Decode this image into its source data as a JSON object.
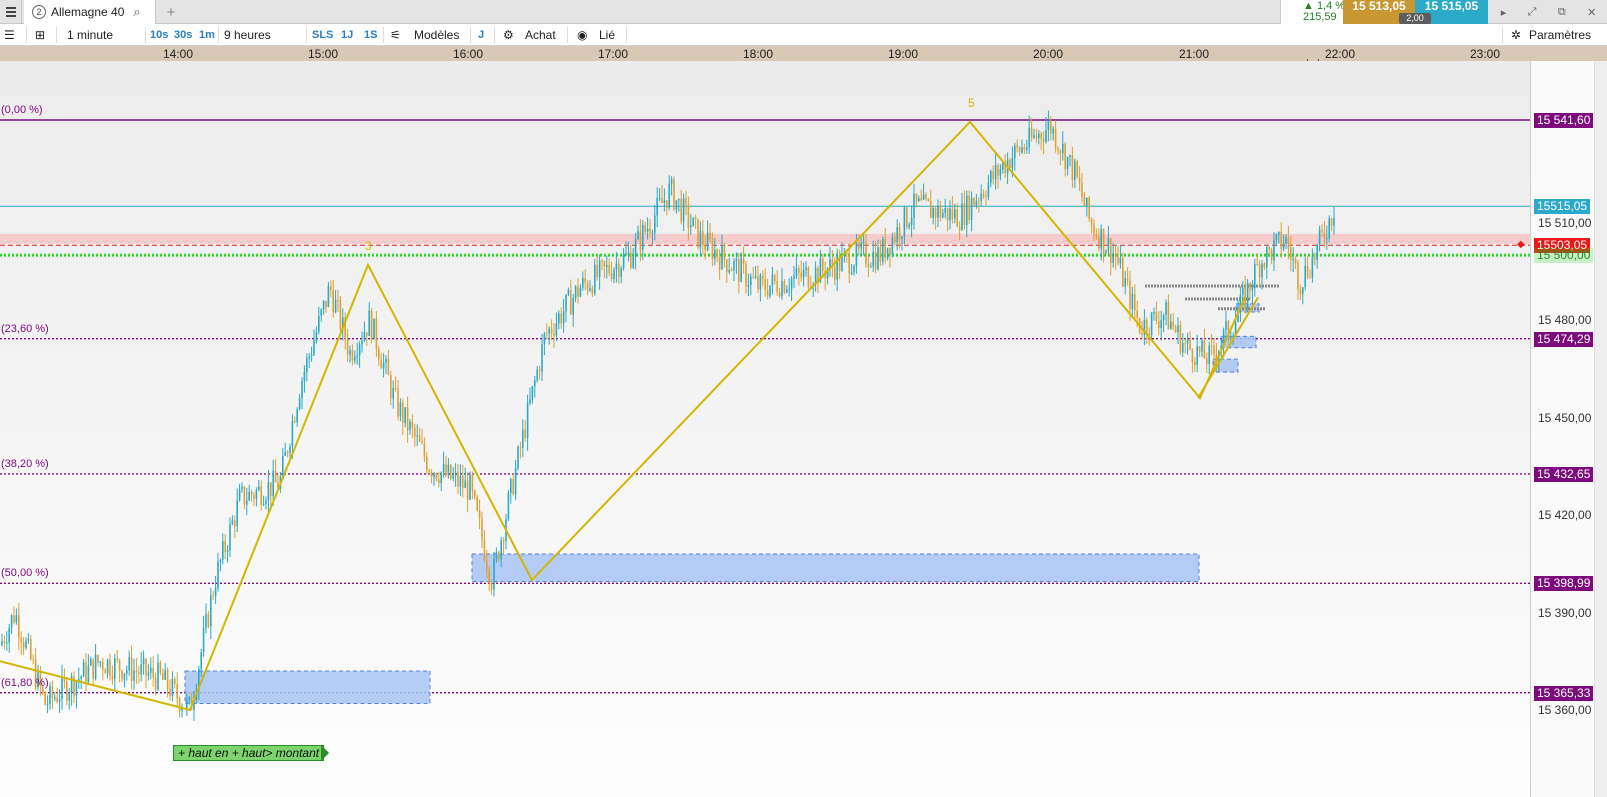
{
  "tabbar": {
    "tab_number": "2",
    "tab_title": "Allemagne 40",
    "add_tab": "+"
  },
  "quote": {
    "change_pct": "▲ 1,4 %",
    "change_abs": "215,59",
    "sell": "15 513,05",
    "buy": "15 515,05",
    "spread": "2,00"
  },
  "toolbar": {
    "interval": "1 minute",
    "quick_intervals": [
      "10s",
      "30s",
      "1m"
    ],
    "period": "9 heures",
    "quick_periods": [
      "SLS",
      "1J",
      "1S"
    ],
    "models": "Modèles",
    "j": "J",
    "buy": "Achat",
    "linked": "Lié",
    "settings": "Paramètres"
  },
  "time_axis": [
    "14:00",
    "15:00",
    "16:00",
    "17:00",
    "18:00",
    "19:00",
    "20:00",
    "21:00",
    "22:00",
    "23:00"
  ],
  "price_axis": [
    "15 510,00",
    "15 480,00",
    "15 450,00",
    "15 420,00",
    "15 390,00",
    "15 360,00"
  ],
  "price_tags": [
    {
      "label": "15 541,60",
      "color": "#7d0b7d",
      "price": 15541.6
    },
    {
      "label": "15515,05",
      "color": "#2aa9c9",
      "price": 15515.05
    },
    {
      "label": "15503,05",
      "color": "#e81919",
      "price": 15503.05
    },
    {
      "label": "15 500,00",
      "color": "#27d627",
      "price": 15500.0
    },
    {
      "label": "15 474,29",
      "color": "#7d0b7d",
      "price": 15474.29
    },
    {
      "label": "15 432,65",
      "color": "#7d0b7d",
      "price": 15432.65
    },
    {
      "label": "15 398,99",
      "color": "#7d0b7d",
      "price": 15398.99
    },
    {
      "label": "15 365,33",
      "color": "#7d0b7d",
      "price": 15365.33
    }
  ],
  "fib_levels": [
    {
      "label": "(0,00 %)",
      "price": 15541.6
    },
    {
      "label": "(23,60 %)",
      "price": 15474.29
    },
    {
      "label": "(38,20 %)",
      "price": 15432.65
    },
    {
      "label": "(50,00 %)",
      "price": 15398.99
    },
    {
      "label": "(61,80 %)",
      "price": 15365.33
    }
  ],
  "wave_labels": [
    "3",
    "5"
  ],
  "annotation": "+ haut en + haut> montant",
  "colors": {
    "fib": "#7d0b7d",
    "wave": "#d4b600",
    "candle_up": "#2aa9c9",
    "candle_down": "#e0a030",
    "zone": "#a9c4f5",
    "current_ask": "#2aa9c9",
    "current_bid": "#e81919",
    "level_green": "#27d627"
  }
}
